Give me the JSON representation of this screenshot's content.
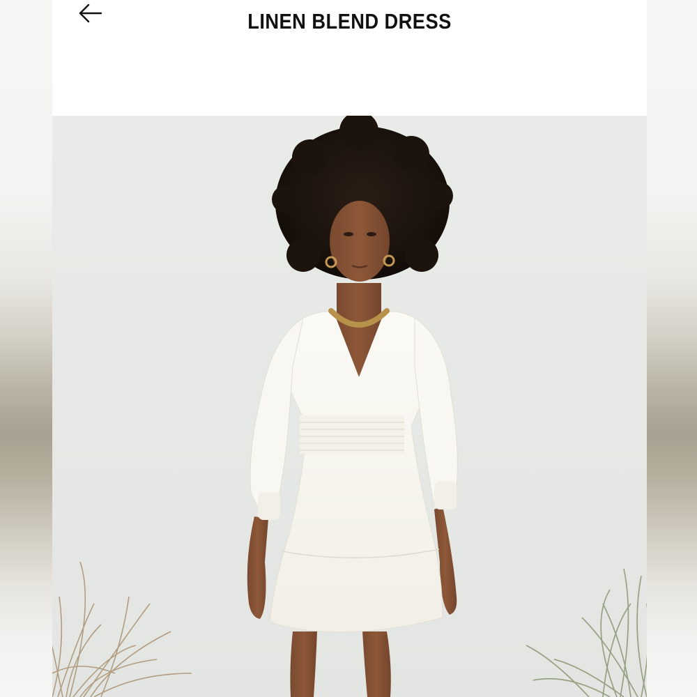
{
  "header": {
    "back_icon": "arrow-left-icon",
    "title": "LINEN BLEND DRESS"
  },
  "product_image": {
    "subject": "model-in-dress-photo"
  }
}
